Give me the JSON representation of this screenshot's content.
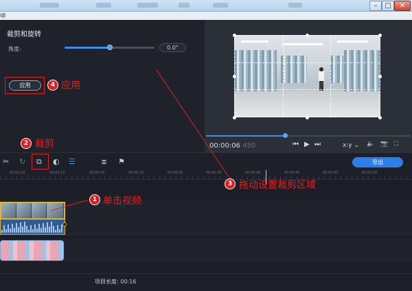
{
  "titlebar": {
    "menu_item": "动"
  },
  "crop_panel": {
    "title": "裁剪和旋转",
    "angle_label": "角度:",
    "angle_value": "0.0°",
    "angle_slider_fraction": 0.5,
    "apply_label": "应用"
  },
  "preview": {
    "timecode_main": "00:00:06",
    "timecode_frames": "450",
    "playback_fraction": 0.385,
    "aspect_label": "x:y",
    "controls": {
      "prev": "⏮",
      "play": "▶",
      "next": "⏭",
      "volume": "🔈",
      "snapshot": "📷",
      "fullscreen": "⛶"
    }
  },
  "toolbar": {
    "export_label": "导出",
    "icons": [
      "scissors-icon",
      "redo-icon",
      "crop-icon",
      "color-icon",
      "equalizer-icon",
      "pip-icon",
      "flag-icon"
    ]
  },
  "ruler": {
    "labels": [
      "00:00:10",
      "00:00:13",
      "00:00:20",
      "00:00:25",
      "00:00:30",
      "00:00:35",
      "00:00:40",
      "00:00:45",
      "00:00:50",
      "00:00:55"
    ]
  },
  "footer": {
    "project_length": "项目长度: 00:16"
  },
  "annotations": {
    "step1": {
      "number": "1",
      "text": "单击视频"
    },
    "step2": {
      "number": "2",
      "text": "裁剪"
    },
    "step3": {
      "number": "3",
      "text": "拖动设置裁剪区域"
    },
    "step4": {
      "number": "4",
      "text": "应用"
    },
    "color": "#e02020"
  },
  "colors": {
    "accent": "#3f8ef0",
    "clip_border": "#e8b320",
    "background": "#1b1e26"
  }
}
